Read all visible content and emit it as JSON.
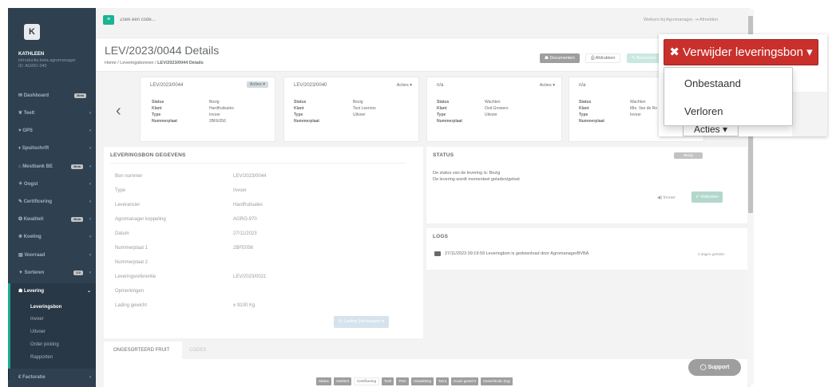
{
  "sidebar": {
    "logo": "K",
    "profile_name": "KATHLEEN",
    "profile_sub1": "introductie.beta.agromanager",
    "profile_sub2": "ID: AGRO-340",
    "items": [
      {
        "label": "✉ Dashboard",
        "badge": "Beta",
        "chev": ""
      },
      {
        "label": "❦ Teelt",
        "badge": "",
        "chev": "‹"
      },
      {
        "label": "♥ GPS",
        "badge": "",
        "chev": "‹"
      },
      {
        "label": "♦ Spuitschrift",
        "badge": "",
        "chev": "‹"
      },
      {
        "label": "⌂ Mestbank BE",
        "badge": "Beta",
        "chev": "‹"
      },
      {
        "label": "⚘ Oogst",
        "badge": "",
        "chev": "‹"
      },
      {
        "label": "✎ Certificering",
        "badge": "",
        "chev": "‹"
      },
      {
        "label": "❂ Kwaliteit",
        "badge": "Beta",
        "chev": "‹"
      },
      {
        "label": "❄ Koeling",
        "badge": "",
        "chev": "‹"
      },
      {
        "label": "▤ Voorraad",
        "badge": "",
        "chev": "‹"
      },
      {
        "label": "▼ Sorteren",
        "badge": "0.0",
        "chev": "‹"
      }
    ],
    "active": {
      "label": "☗ Levering",
      "chev": "⌄"
    },
    "sub_items": [
      "Leveringsbon",
      "Invoer",
      "Uitvoer",
      "Order picking",
      "Rapporten"
    ],
    "bottom": {
      "label": "€ Facturatie",
      "chev": "‹"
    }
  },
  "topbar": {
    "menu_icon": "≡",
    "search_placeholder": "Zoek een code...",
    "welcome": "Welkom bij Agromanager.",
    "logout": "⇥ Afmelden"
  },
  "heading": {
    "title": "LEV/2023/0044 Details",
    "crumb1": "Home",
    "sep": "/",
    "crumb2": "Leveringsbonnen",
    "crumb3": "LEV/2023/0044 Details",
    "btn_documents": "☗ Documenten",
    "btn_print": "⎙ Afdrukken",
    "btn_edit": "✎ Bewerken"
  },
  "carousel": {
    "prev": "‹",
    "cards": [
      {
        "title": "LEV/2023/0044",
        "actions": "Acties ▾",
        "rows": [
          [
            "Status",
            "Bezig"
          ],
          [
            "Klant",
            "Hardfruitsales"
          ],
          [
            "Type",
            "Invoer"
          ],
          [
            "Nummerplaat",
            "2BFE056"
          ]
        ]
      },
      {
        "title": "LEV/2023/0040",
        "actions": "Acties ▾",
        "rows": [
          [
            "Status",
            "Bezig"
          ],
          [
            "Klant",
            "Test Leerons"
          ],
          [
            "Type",
            "Uitvoer"
          ],
          [
            "Nummerplaat",
            ""
          ]
        ]
      },
      {
        "title": "n/a",
        "actions": "Acties ▾",
        "rows": [
          [
            "Status",
            "Wachten"
          ],
          [
            "Klant",
            "Ooit Growers"
          ],
          [
            "Type",
            "Uitvoer"
          ],
          [
            "Nummerplaat",
            ""
          ]
        ]
      },
      {
        "title": "n/a",
        "actions": "",
        "rows": [
          [
            "Status",
            "Wachten"
          ],
          [
            "Klant",
            "Mts. Van de Ro"
          ],
          [
            "Type",
            "Invoer"
          ],
          [
            "Nummerplaat",
            ""
          ]
        ]
      }
    ]
  },
  "details": {
    "title": "LEVERINGSBON GEGEVENS",
    "rows": [
      [
        "Bon nummer",
        "LEV/2023/0044"
      ],
      [
        "Type",
        "Invoer"
      ],
      [
        "Leverancier",
        "Hardfruitsales"
      ],
      [
        "Agromanager koppeling",
        "AGRO-970"
      ],
      [
        "Datum",
        "27/11/2023"
      ],
      [
        "Nummerplaat 1",
        "2BFE056"
      ],
      [
        "Nummerplaat 2",
        ""
      ],
      [
        "Leveringsreferentie",
        "LEV/2023/0021"
      ],
      [
        "Opmerkingen",
        ""
      ],
      [
        "Lading gewicht",
        "± 9100 Kg"
      ]
    ],
    "lading_button": "⚖ Lading (her)wegen ▾"
  },
  "status": {
    "title": "STATUS",
    "badge": "Bezig",
    "line1": "De status van de levering is: Bezig",
    "line2": "De levering wordt momenteel geladen/gelost",
    "btn_invoer": "◀) Invoer",
    "btn_voltooien": "✔ Voltooien"
  },
  "logs": {
    "title": "LOGS",
    "entry": "27/11/2023 09:19:59  Leveringbon is gedownload door AgromanagerBVBA",
    "time": "3 dagen geleden"
  },
  "tabs": {
    "active": "ONGESORTEERD FRUIT",
    "inactive": "CODES",
    "filters": [
      {
        "label": "Status",
        "on": true
      },
      {
        "label": "Variëteit",
        "on": true
      },
      {
        "label": "Certificering",
        "on": false
      },
      {
        "label": "Teelt",
        "on": true
      },
      {
        "label": "PNA",
        "on": true
      },
      {
        "label": "Verpakking",
        "on": true
      },
      {
        "label": "Tarra",
        "on": true
      },
      {
        "label": "Exact gewicht",
        "on": true
      },
      {
        "label": "Gewichtcalc (Kg)",
        "on": true
      }
    ]
  },
  "support": "◯ Support",
  "dropdown": {
    "delete_button": "✖ Verwijder leveringsbon ▾",
    "items": [
      "Onbestaand",
      "Verloren"
    ],
    "actions_button": "Acties ▾"
  },
  "colors": {
    "sidebar": "#2f4050",
    "accent": "#1ab394",
    "danger": "#c9302c"
  }
}
